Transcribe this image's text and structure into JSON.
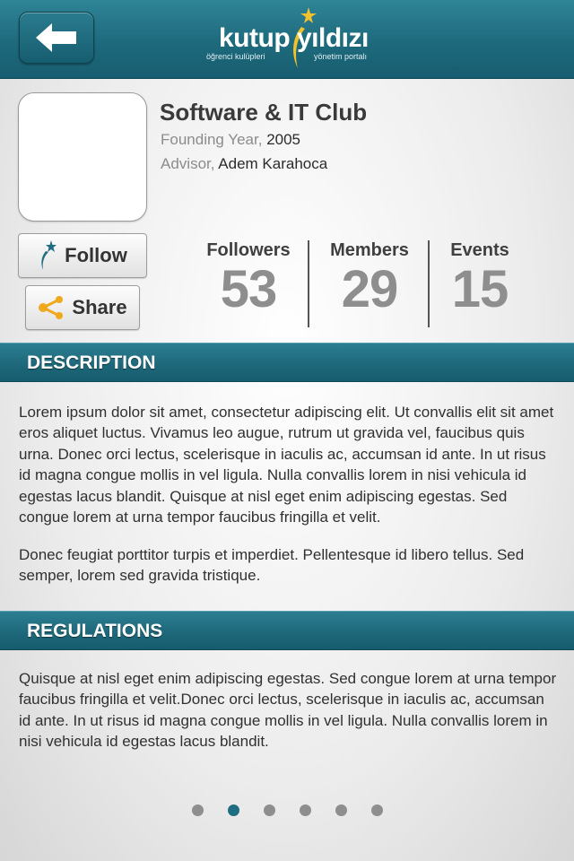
{
  "header": {
    "logo_main": "kutup yıldızı",
    "logo_left_sub": "öğrenci kulüpleri",
    "logo_right_sub": "yönetim portalı",
    "back_icon": "arrow-left-icon"
  },
  "club": {
    "name": "Software & IT Club",
    "founding_label": "Founding Year,",
    "founding_value": "2005",
    "advisor_label": "Advisor,",
    "advisor_value": "Adem Karahoca"
  },
  "actions": {
    "follow_label": "Follow",
    "follow_icon": "star-swoosh-icon",
    "share_label": "Share",
    "share_icon": "share-icon"
  },
  "stats": [
    {
      "label": "Followers",
      "value": "53"
    },
    {
      "label": "Members",
      "value": "29"
    },
    {
      "label": "Events",
      "value": "15"
    }
  ],
  "description": {
    "title": "DESCRIPTION",
    "paragraph1": "Lorem ipsum dolor sit amet, consectetur adipiscing elit. Ut convallis elit sit amet eros aliquet luctus. Vivamus leo augue, rutrum ut gravida vel, faucibus quis urna. Donec orci lectus, scelerisque in iaculis ac, accumsan id ante. In ut risus id magna congue mollis in vel ligula. Nulla convallis lorem in nisi vehicula id egestas lacus blandit. Quisque at nisl eget enim adipiscing egestas. Sed congue lorem at urna tempor faucibus fringilla et velit.",
    "paragraph2": "Donec feugiat porttitor turpis et imperdiet. Pellentesque id libero tellus. Sed semper, lorem sed gravida tristique."
  },
  "regulations": {
    "title": "REGULATIONS",
    "paragraph1": "Quisque at nisl eget enim adipiscing egestas. Sed congue lorem at urna tempor faucibus fringilla et velit.Donec orci lectus, scelerisque in iaculis ac, accumsan id ante. In ut risus id magna congue mollis in vel ligula. Nulla convallis lorem in nisi vehicula id egestas lacus blandit."
  },
  "pagination": {
    "total": 6,
    "active_index": 1,
    "colors": {
      "inactive": "#8e8e8e",
      "active": "#1f6d80"
    }
  },
  "colors": {
    "header": "#1e6a7d",
    "section_bar": "#1d6779"
  }
}
